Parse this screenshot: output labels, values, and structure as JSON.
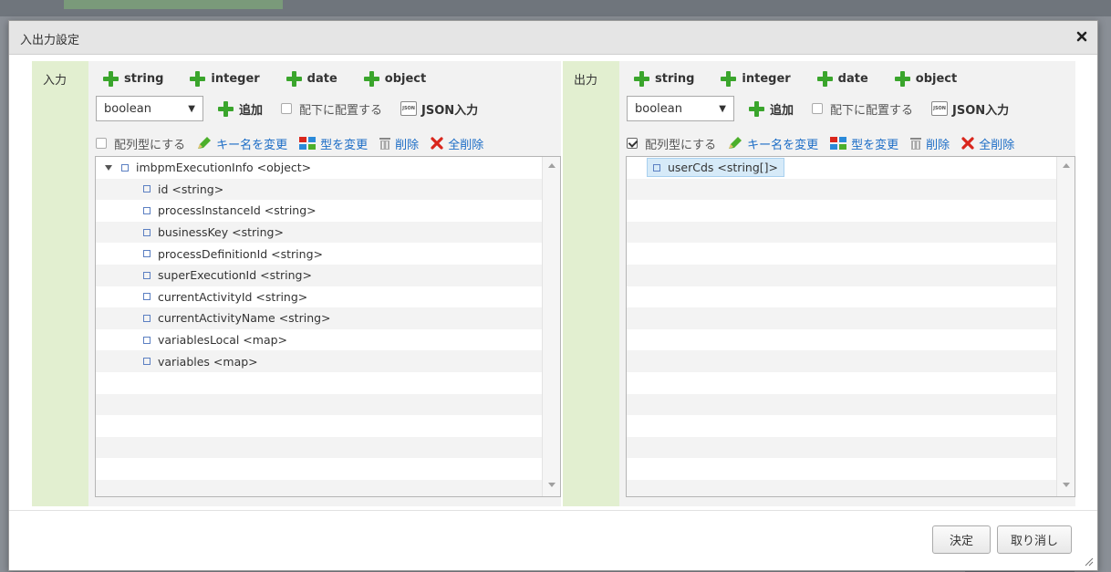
{
  "dialog": {
    "title": "入出力設定",
    "ok_label": "決定",
    "cancel_label": "取り消し"
  },
  "input_panel": {
    "label": "入力",
    "type_buttons": [
      "string",
      "integer",
      "date",
      "object"
    ],
    "select_value": "boolean",
    "add_label": "追加",
    "place_under_label": "配下に配置する",
    "place_under_checked": false,
    "json_label": "JSON入力",
    "json_icon_text": "JSON",
    "array_label": "配列型にする",
    "array_checked": false,
    "rename_label": "キー名を変更",
    "change_type_label": "型を変更",
    "delete_label": "削除",
    "delete_all_label": "全削除",
    "tree": {
      "root": "imbpmExecutionInfo <object>",
      "children": [
        "id <string>",
        "processInstanceId <string>",
        "businessKey <string>",
        "processDefinitionId <string>",
        "superExecutionId <string>",
        "currentActivityId <string>",
        "currentActivityName <string>",
        "variablesLocal <map>",
        "variables <map>"
      ]
    }
  },
  "output_panel": {
    "label": "出力",
    "type_buttons": [
      "string",
      "integer",
      "date",
      "object"
    ],
    "select_value": "boolean",
    "add_label": "追加",
    "place_under_label": "配下に配置する",
    "place_under_checked": false,
    "json_label": "JSON入力",
    "json_icon_text": "JSON",
    "array_label": "配列型にする",
    "array_checked": true,
    "rename_label": "キー名を変更",
    "change_type_label": "型を変更",
    "delete_label": "削除",
    "delete_all_label": "全削除",
    "tree": {
      "items": [
        "userCds <string[]>"
      ]
    }
  },
  "colors": {
    "plus_green": "#3aa52c",
    "label_bg": "#e2efd0",
    "link_blue": "#1b6cc6",
    "delete_red": "#d9261c"
  }
}
